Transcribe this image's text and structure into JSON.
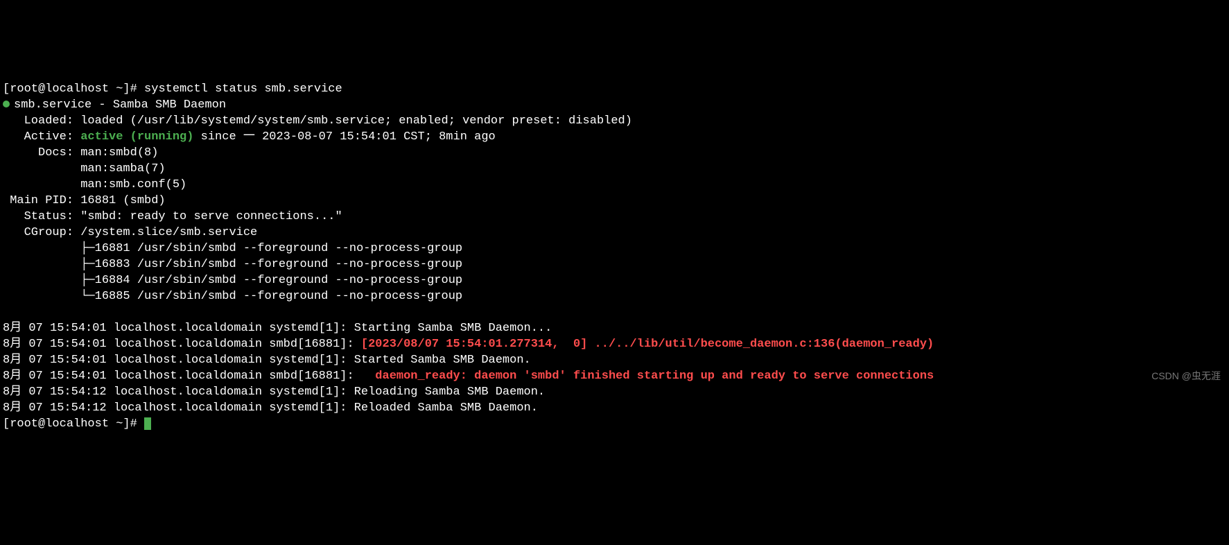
{
  "prompt1": "[root@localhost ~]# ",
  "command": "systemctl status smb.service",
  "unit_header_prefix": "smb.service - ",
  "unit_description": "Samba SMB Daemon",
  "loaded_label": "   Loaded: ",
  "loaded_value": "loaded (/usr/lib/systemd/system/smb.service; enabled; vendor preset: disabled)",
  "active_label": "   Active: ",
  "active_status": "active (running)",
  "active_since": " since 一 2023-08-07 15:54:01 CST; 8min ago",
  "docs_label": "     Docs: ",
  "docs": [
    "man:smbd(8)",
    "man:samba(7)",
    "man:smb.conf(5)"
  ],
  "docs_indent": "           ",
  "mainpid_label": " Main PID: ",
  "mainpid_value": "16881 (smbd)",
  "status_label": "   Status: ",
  "status_value": "\"smbd: ready to serve connections...\"",
  "cgroup_label": "   CGroup: ",
  "cgroup_path": "/system.slice/smb.service",
  "cgroup_indent": "           ",
  "cgroup_procs": [
    "├─16881 /usr/sbin/smbd --foreground --no-process-group",
    "├─16883 /usr/sbin/smbd --foreground --no-process-group",
    "├─16884 /usr/sbin/smbd --foreground --no-process-group",
    "└─16885 /usr/sbin/smbd --foreground --no-process-group"
  ],
  "log_lines": [
    {
      "prefix": "8月 07 15:54:01 localhost.localdomain systemd[1]: ",
      "msg": "Starting Samba SMB Daemon...",
      "color": "white"
    },
    {
      "prefix": "8月 07 15:54:01 localhost.localdomain smbd[16881]: ",
      "msg": "[2023/08/07 15:54:01.277314,  0] ../../lib/util/become_daemon.c:136(daemon_ready)",
      "color": "red"
    },
    {
      "prefix": "8月 07 15:54:01 localhost.localdomain systemd[1]: ",
      "msg": "Started Samba SMB Daemon.",
      "color": "white"
    },
    {
      "prefix": "8月 07 15:54:01 localhost.localdomain smbd[16881]:   ",
      "msg": "daemon_ready: daemon 'smbd' finished starting up and ready to serve connections",
      "color": "red"
    },
    {
      "prefix": "8月 07 15:54:12 localhost.localdomain systemd[1]: ",
      "msg": "Reloading Samba SMB Daemon.",
      "color": "white"
    },
    {
      "prefix": "8月 07 15:54:12 localhost.localdomain systemd[1]: ",
      "msg": "Reloaded Samba SMB Daemon.",
      "color": "white"
    }
  ],
  "prompt2": "[root@localhost ~]# ",
  "watermark": "CSDN @虫无涯"
}
